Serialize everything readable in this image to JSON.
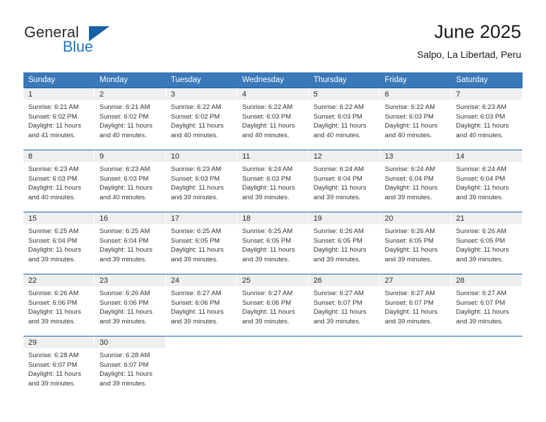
{
  "brand": {
    "word_one": "General",
    "word_two": "Blue",
    "triangle_icon": "triangle-icon",
    "accent_color": "#1f77c2",
    "triangle_color": "#1461a8"
  },
  "header": {
    "title": "June 2025",
    "subtitle": "Salpo, La Libertad, Peru"
  },
  "theme": {
    "header_row_bg": "#3b78b8",
    "cell_top_border": "#1461a8",
    "daynum_bg": "#efefef",
    "text_color": "#333333"
  },
  "calendar": {
    "weekday_headers": [
      "Sunday",
      "Monday",
      "Tuesday",
      "Wednesday",
      "Thursday",
      "Friday",
      "Saturday"
    ],
    "weeks": [
      [
        {
          "day": "1",
          "sunrise": "Sunrise: 6:21 AM",
          "sunset": "Sunset: 6:02 PM",
          "daylight": "Daylight: 11 hours and 41 minutes."
        },
        {
          "day": "2",
          "sunrise": "Sunrise: 6:21 AM",
          "sunset": "Sunset: 6:02 PM",
          "daylight": "Daylight: 11 hours and 40 minutes."
        },
        {
          "day": "3",
          "sunrise": "Sunrise: 6:22 AM",
          "sunset": "Sunset: 6:02 PM",
          "daylight": "Daylight: 11 hours and 40 minutes."
        },
        {
          "day": "4",
          "sunrise": "Sunrise: 6:22 AM",
          "sunset": "Sunset: 6:03 PM",
          "daylight": "Daylight: 11 hours and 40 minutes."
        },
        {
          "day": "5",
          "sunrise": "Sunrise: 6:22 AM",
          "sunset": "Sunset: 6:03 PM",
          "daylight": "Daylight: 11 hours and 40 minutes."
        },
        {
          "day": "6",
          "sunrise": "Sunrise: 6:22 AM",
          "sunset": "Sunset: 6:03 PM",
          "daylight": "Daylight: 11 hours and 40 minutes."
        },
        {
          "day": "7",
          "sunrise": "Sunrise: 6:23 AM",
          "sunset": "Sunset: 6:03 PM",
          "daylight": "Daylight: 11 hours and 40 minutes."
        }
      ],
      [
        {
          "day": "8",
          "sunrise": "Sunrise: 6:23 AM",
          "sunset": "Sunset: 6:03 PM",
          "daylight": "Daylight: 11 hours and 40 minutes."
        },
        {
          "day": "9",
          "sunrise": "Sunrise: 6:23 AM",
          "sunset": "Sunset: 6:03 PM",
          "daylight": "Daylight: 11 hours and 40 minutes."
        },
        {
          "day": "10",
          "sunrise": "Sunrise: 6:23 AM",
          "sunset": "Sunset: 6:03 PM",
          "daylight": "Daylight: 11 hours and 39 minutes."
        },
        {
          "day": "11",
          "sunrise": "Sunrise: 6:24 AM",
          "sunset": "Sunset: 6:03 PM",
          "daylight": "Daylight: 11 hours and 39 minutes."
        },
        {
          "day": "12",
          "sunrise": "Sunrise: 6:24 AM",
          "sunset": "Sunset: 6:04 PM",
          "daylight": "Daylight: 11 hours and 39 minutes."
        },
        {
          "day": "13",
          "sunrise": "Sunrise: 6:24 AM",
          "sunset": "Sunset: 6:04 PM",
          "daylight": "Daylight: 11 hours and 39 minutes."
        },
        {
          "day": "14",
          "sunrise": "Sunrise: 6:24 AM",
          "sunset": "Sunset: 6:04 PM",
          "daylight": "Daylight: 11 hours and 39 minutes."
        }
      ],
      [
        {
          "day": "15",
          "sunrise": "Sunrise: 6:25 AM",
          "sunset": "Sunset: 6:04 PM",
          "daylight": "Daylight: 11 hours and 39 minutes."
        },
        {
          "day": "16",
          "sunrise": "Sunrise: 6:25 AM",
          "sunset": "Sunset: 6:04 PM",
          "daylight": "Daylight: 11 hours and 39 minutes."
        },
        {
          "day": "17",
          "sunrise": "Sunrise: 6:25 AM",
          "sunset": "Sunset: 6:05 PM",
          "daylight": "Daylight: 11 hours and 39 minutes."
        },
        {
          "day": "18",
          "sunrise": "Sunrise: 6:25 AM",
          "sunset": "Sunset: 6:05 PM",
          "daylight": "Daylight: 11 hours and 39 minutes."
        },
        {
          "day": "19",
          "sunrise": "Sunrise: 6:26 AM",
          "sunset": "Sunset: 6:05 PM",
          "daylight": "Daylight: 11 hours and 39 minutes."
        },
        {
          "day": "20",
          "sunrise": "Sunrise: 6:26 AM",
          "sunset": "Sunset: 6:05 PM",
          "daylight": "Daylight: 11 hours and 39 minutes."
        },
        {
          "day": "21",
          "sunrise": "Sunrise: 6:26 AM",
          "sunset": "Sunset: 6:05 PM",
          "daylight": "Daylight: 11 hours and 39 minutes."
        }
      ],
      [
        {
          "day": "22",
          "sunrise": "Sunrise: 6:26 AM",
          "sunset": "Sunset: 6:06 PM",
          "daylight": "Daylight: 11 hours and 39 minutes."
        },
        {
          "day": "23",
          "sunrise": "Sunrise: 6:26 AM",
          "sunset": "Sunset: 6:06 PM",
          "daylight": "Daylight: 11 hours and 39 minutes."
        },
        {
          "day": "24",
          "sunrise": "Sunrise: 6:27 AM",
          "sunset": "Sunset: 6:06 PM",
          "daylight": "Daylight: 11 hours and 39 minutes."
        },
        {
          "day": "25",
          "sunrise": "Sunrise: 6:27 AM",
          "sunset": "Sunset: 6:06 PM",
          "daylight": "Daylight: 11 hours and 39 minutes."
        },
        {
          "day": "26",
          "sunrise": "Sunrise: 6:27 AM",
          "sunset": "Sunset: 6:07 PM",
          "daylight": "Daylight: 11 hours and 39 minutes."
        },
        {
          "day": "27",
          "sunrise": "Sunrise: 6:27 AM",
          "sunset": "Sunset: 6:07 PM",
          "daylight": "Daylight: 11 hours and 39 minutes."
        },
        {
          "day": "28",
          "sunrise": "Sunrise: 6:27 AM",
          "sunset": "Sunset: 6:07 PM",
          "daylight": "Daylight: 11 hours and 39 minutes."
        }
      ],
      [
        {
          "day": "29",
          "sunrise": "Sunrise: 6:28 AM",
          "sunset": "Sunset: 6:07 PM",
          "daylight": "Daylight: 11 hours and 39 minutes."
        },
        {
          "day": "30",
          "sunrise": "Sunrise: 6:28 AM",
          "sunset": "Sunset: 6:07 PM",
          "daylight": "Daylight: 11 hours and 39 minutes."
        },
        {
          "day": "",
          "sunrise": "",
          "sunset": "",
          "daylight": ""
        },
        {
          "day": "",
          "sunrise": "",
          "sunset": "",
          "daylight": ""
        },
        {
          "day": "",
          "sunrise": "",
          "sunset": "",
          "daylight": ""
        },
        {
          "day": "",
          "sunrise": "",
          "sunset": "",
          "daylight": ""
        },
        {
          "day": "",
          "sunrise": "",
          "sunset": "",
          "daylight": ""
        }
      ]
    ]
  }
}
